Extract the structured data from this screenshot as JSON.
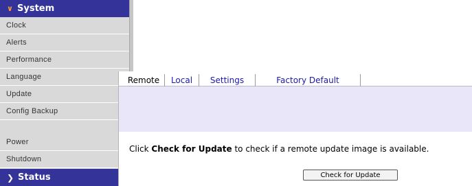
{
  "sidebar": {
    "system_label": "System",
    "items": [
      "Clock",
      "Alerts",
      "Performance",
      "Language",
      "Update",
      "Config Backup",
      "Power",
      "Shutdown"
    ],
    "status_label": "Status",
    "header_color": "#333399",
    "system_chevron_color": "#ff9933"
  },
  "tabs": [
    {
      "label": "Remote",
      "active": true
    },
    {
      "label": "Local",
      "active": false
    },
    {
      "label": "Settings",
      "active": false
    },
    {
      "label": "Factory Default",
      "active": false
    }
  ],
  "main": {
    "desc_pre": "Click ",
    "desc_bold": "Check for Update",
    "desc_post": " to check if a remote update image is available.",
    "button_label": "Check for Update",
    "tab_link_color": "#1a1aa8",
    "band_color": "#e8e6f8"
  }
}
